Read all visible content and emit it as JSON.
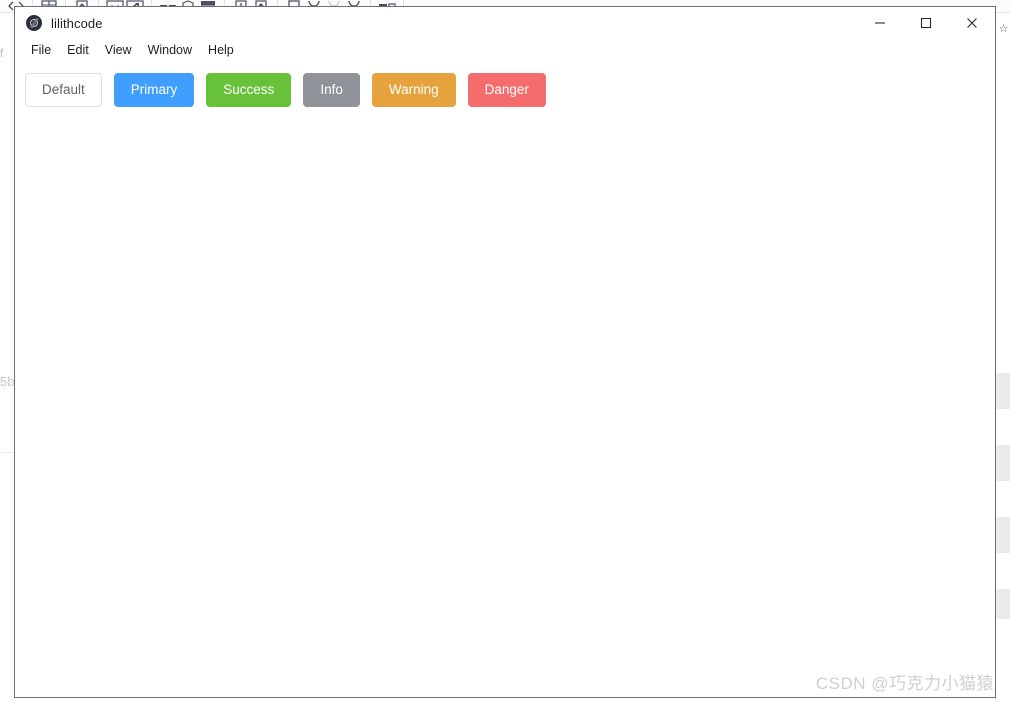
{
  "window": {
    "title": "lilithcode",
    "app_icon": "lilithcode-logo-icon",
    "controls": {
      "minimize": "minimize-icon",
      "maximize": "maximize-icon",
      "close": "close-icon"
    }
  },
  "menubar": {
    "items": [
      {
        "label": "File"
      },
      {
        "label": "Edit"
      },
      {
        "label": "View"
      },
      {
        "label": "Window"
      },
      {
        "label": "Help"
      }
    ]
  },
  "content": {
    "buttons": [
      {
        "label": "Default",
        "type": "default",
        "bg": "#ffffff",
        "border": "#dcdfe6",
        "text": "#606266"
      },
      {
        "label": "Primary",
        "type": "primary",
        "bg": "#409eff",
        "border": "#409eff",
        "text": "#ffffff"
      },
      {
        "label": "Success",
        "type": "success",
        "bg": "#67c23a",
        "border": "#67c23a",
        "text": "#ffffff"
      },
      {
        "label": "Info",
        "type": "info",
        "bg": "#909399",
        "border": "#909399",
        "text": "#ffffff"
      },
      {
        "label": "Warning",
        "type": "warning",
        "bg": "#e6a23c",
        "border": "#e6a23c",
        "text": "#ffffff"
      },
      {
        "label": "Danger",
        "type": "danger",
        "bg": "#f56c6c",
        "border": "#f56c6c",
        "text": "#ffffff"
      }
    ]
  },
  "background": {
    "left_text": "5b",
    "corner_text": "f",
    "right_icon": "bookmark-star-icon",
    "toolbar_icons": [
      "code-icon",
      "table-icon",
      "upload-icon",
      "image-icon",
      "link-image-icon",
      "columns-icon",
      "shield-icon",
      "archive-icon",
      "download-icon",
      "export-icon",
      "square-icon",
      "undo-icon",
      "redo-icon",
      "refresh-icon",
      "list-detail-icon"
    ]
  },
  "watermark": {
    "text": "CSDN @巧克力小猫猿"
  }
}
